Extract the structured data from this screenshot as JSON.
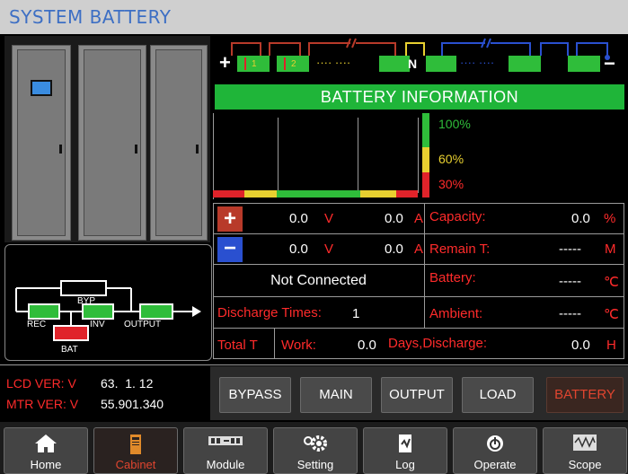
{
  "title": "SYSTEM BATTERY",
  "battery_string": {
    "plus": "+",
    "minus": "−",
    "neutral": "N",
    "cell_labels": [
      "1",
      "2"
    ],
    "dots": "···· ····"
  },
  "battery_info": {
    "header": "BATTERY INFORMATION",
    "levels": [
      "100%",
      "60%",
      "30%"
    ]
  },
  "readings": {
    "pos_sign": "+",
    "neg_sign": "−",
    "pos_voltage": "0.0",
    "pos_current": "0.0",
    "neg_voltage": "0.0",
    "neg_current": "0.0",
    "volt_unit": "V",
    "amp_unit": "A",
    "status": "Not Connected",
    "discharge_label": "Discharge Times:",
    "discharge_value": "1",
    "total_label": "Total T",
    "work_label": "Work:",
    "work_value": "0.0",
    "days_label": "Days,Discharge:",
    "days_value": "0.0",
    "days_unit": "H"
  },
  "capacity": {
    "label": "Capacity:",
    "value": "0.0",
    "unit": "%"
  },
  "remain": {
    "label": "Remain T:",
    "value": "-----",
    "unit": "M"
  },
  "battery_temp": {
    "label": "Battery:",
    "value": "-----",
    "unit": "℃"
  },
  "ambient_temp": {
    "label": "Ambient:",
    "value": "-----",
    "unit": "℃"
  },
  "flow": {
    "byp": "BYP",
    "rec": "REC",
    "inv": "INV",
    "output": "OUTPUT",
    "bat": "BAT"
  },
  "versions": {
    "lcd_label": "LCD VER: V",
    "lcd_value": "63.  1. 12",
    "mtr_label": "MTR VER: V",
    "mtr_value": "55.901.340"
  },
  "tabs": [
    "BYPASS",
    "MAIN",
    "OUTPUT",
    "LOAD",
    "BATTERY"
  ],
  "nav": [
    {
      "label": "Home",
      "icon": "home-icon"
    },
    {
      "label": "Cabinet",
      "icon": "cabinet-icon"
    },
    {
      "label": "Module",
      "icon": "module-icon"
    },
    {
      "label": "Setting",
      "icon": "gear-icon"
    },
    {
      "label": "Log",
      "icon": "log-icon"
    },
    {
      "label": "Operate",
      "icon": "power-icon"
    },
    {
      "label": "Scope",
      "icon": "scope-icon"
    }
  ],
  "colors": {
    "title": "#3d6fc4",
    "accent": "#2fbd3a",
    "red": "#ff2b2b",
    "yellow": "#e8d030",
    "active_tab": "#e0452f"
  }
}
